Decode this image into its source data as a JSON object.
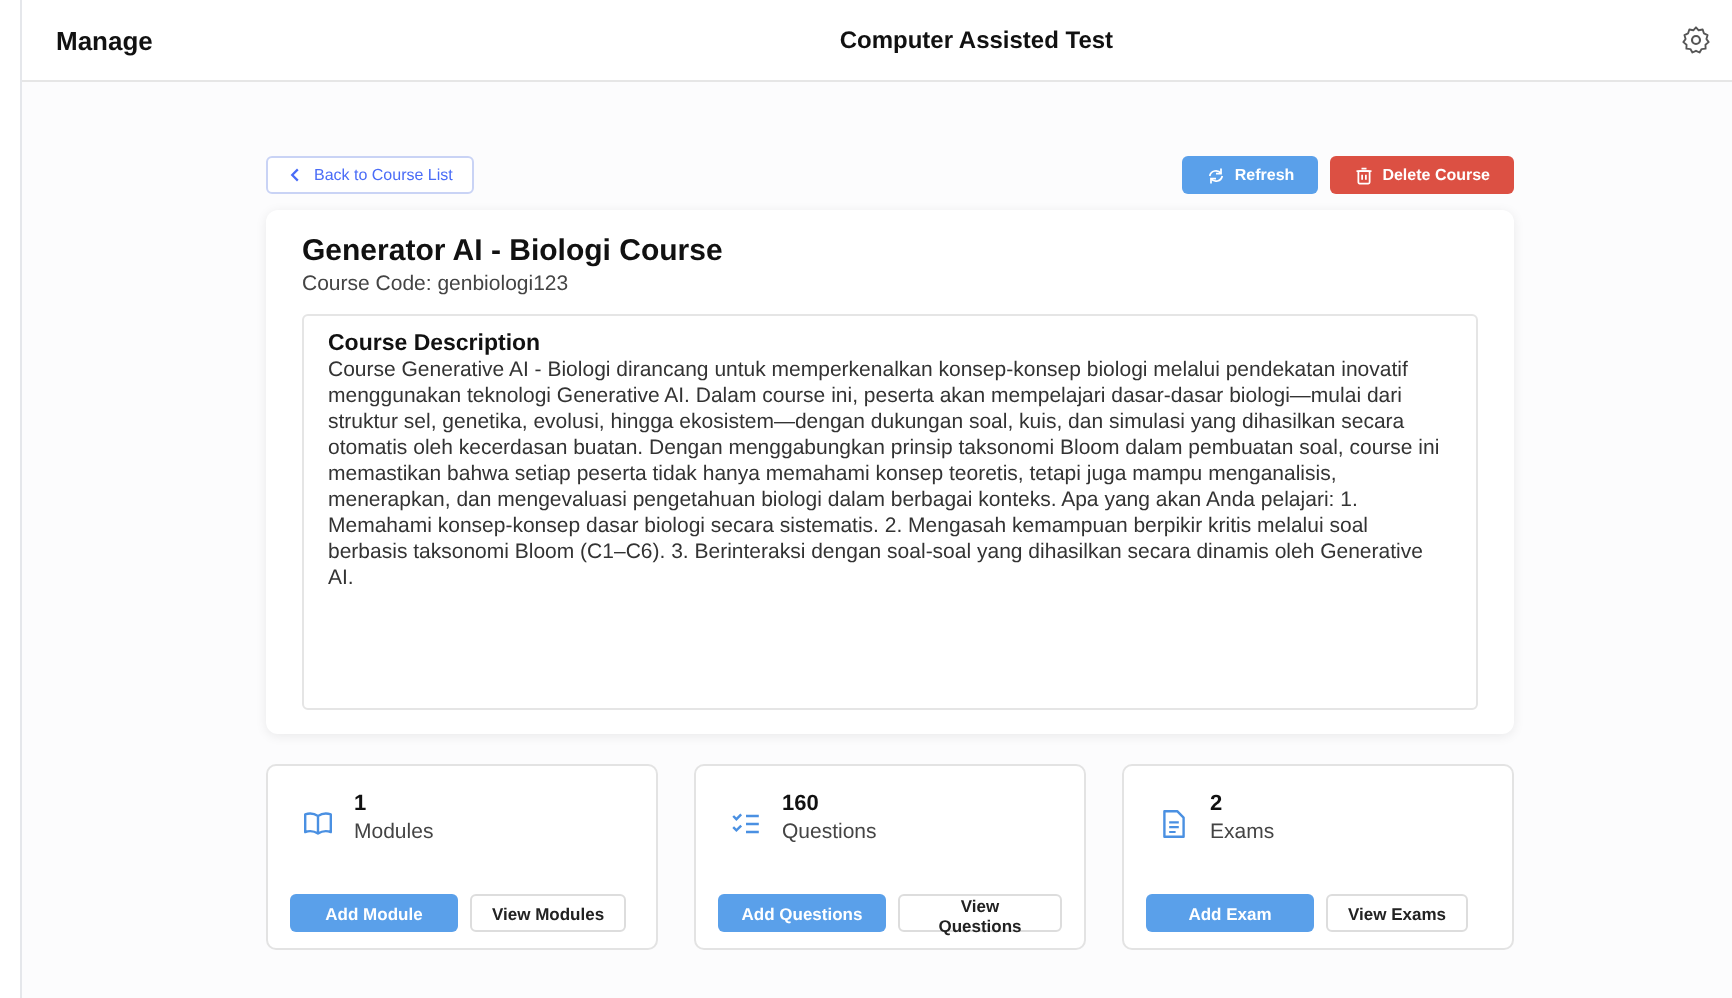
{
  "header": {
    "left": "Manage",
    "title": "Computer Assisted Test"
  },
  "back_button": "Back to Course List",
  "actions": [
    {
      "label": "Refresh",
      "kind": "refresh"
    },
    {
      "label": "Delete Course",
      "kind": "delete"
    }
  ],
  "course": {
    "title": "Generator AI - Biologi Course",
    "code": "Course Code: genbiologi123",
    "description_heading": "Course Description",
    "description": "Course Generative AI - Biologi dirancang untuk memperkenalkan konsep-konsep biologi melalui pendekatan inovatif menggunakan teknologi Generative AI. Dalam course ini, peserta akan mempelajari dasar-dasar biologi—mulai dari struktur sel, genetika, evolusi, hingga ekosistem—dengan dukungan soal, kuis, dan simulasi yang dihasilkan secara otomatis oleh kecerdasan buatan. Dengan menggabungkan prinsip taksonomi Bloom dalam pembuatan soal, course ini memastikan bahwa setiap peserta tidak hanya memahami konsep teoretis, tetapi juga mampu menganalisis, menerapkan, dan mengevaluasi pengetahuan biologi dalam berbagai konteks. Apa yang akan Anda pelajari: 1. Memahami konsep-konsep dasar biologi secara sistematis. 2. Mengasah kemampuan berpikir kritis melalui soal berbasis taksonomi Bloom (C1–C6). 3. Berinteraksi dengan soal-soal yang dihasilkan secara dinamis oleh Generative AI."
  },
  "stats": [
    {
      "kind": "modules",
      "count": "1",
      "label": "Modules",
      "primary": "Add Module",
      "secondary": "View Modules"
    },
    {
      "kind": "questions",
      "count": "160",
      "label": "Questions",
      "primary": "Add Questions",
      "secondary": "View Questions"
    },
    {
      "kind": "exams",
      "count": "2",
      "label": "Exams",
      "primary": "Add Exam",
      "secondary": "View Exams"
    }
  ]
}
